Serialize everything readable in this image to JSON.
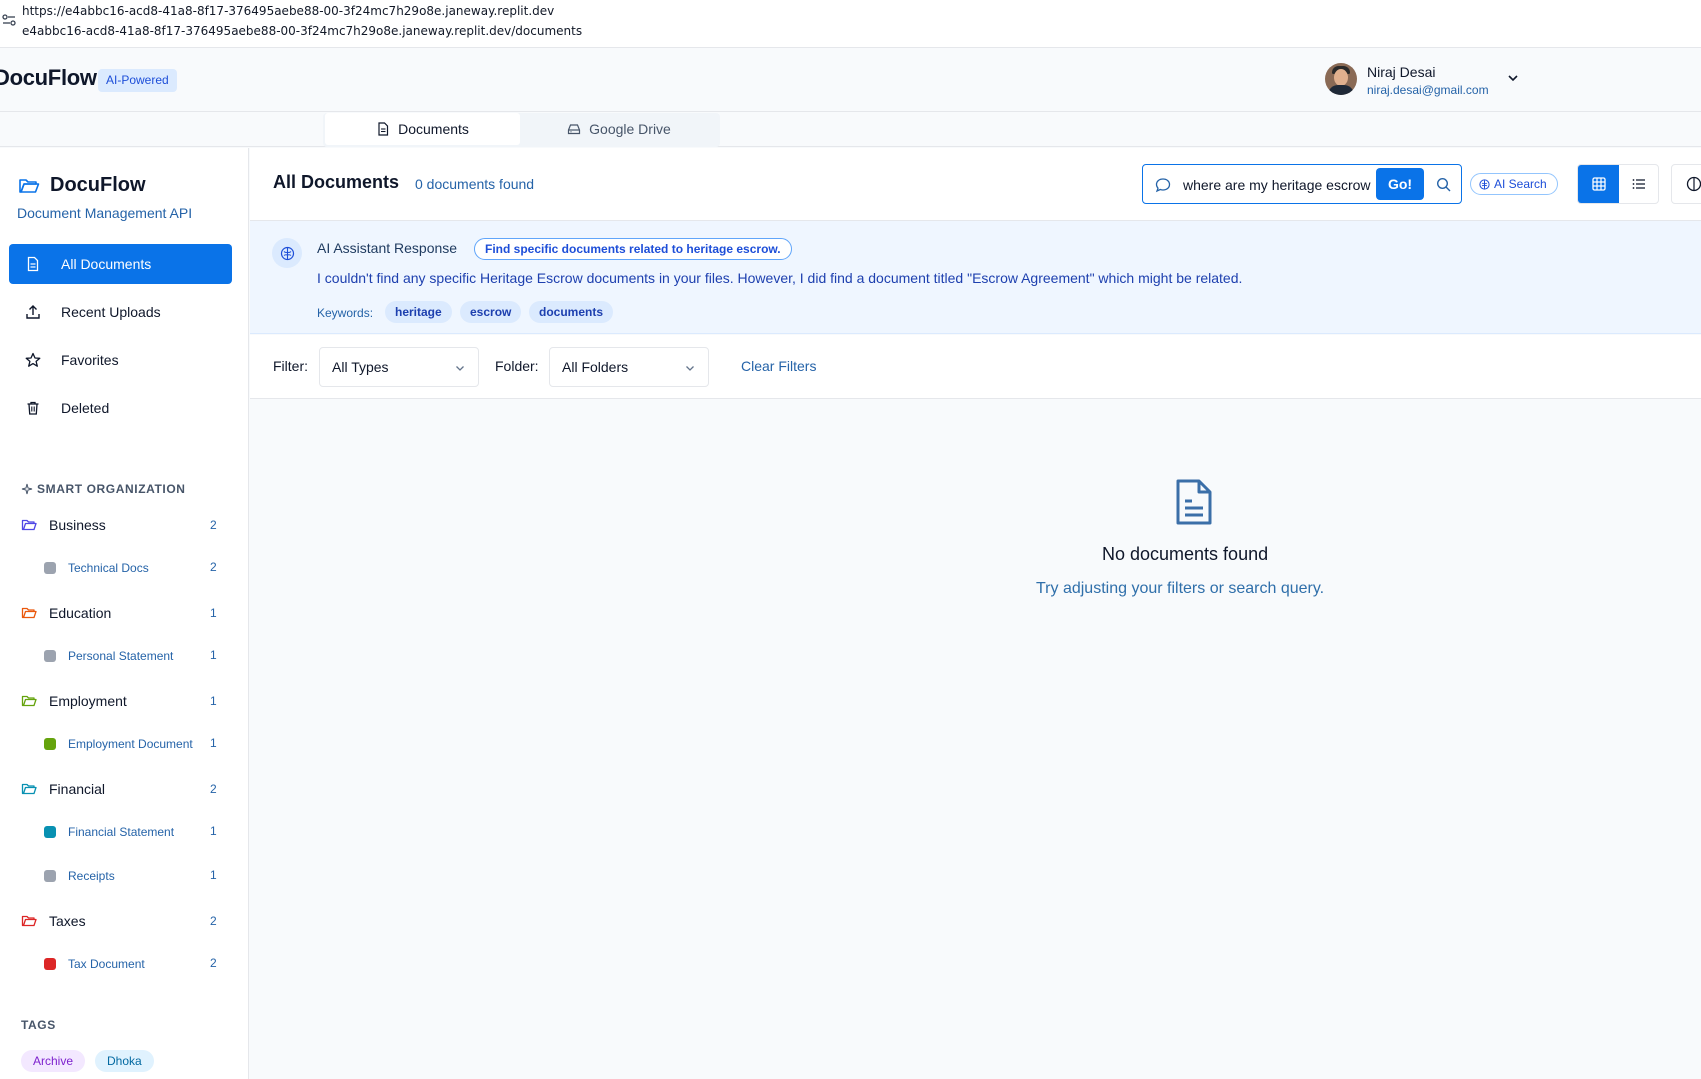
{
  "browser": {
    "url_line1": "https://e4abbc16-acd8-41a8-8f17-376495aebe88-00-3f24mc7h29o8e.janeway.replit.dev",
    "url_line2": "e4abbc16-acd8-41a8-8f17-376495aebe88-00-3f24mc7h29o8e.janeway.replit.dev/documents"
  },
  "header": {
    "brand": "DocuFlow",
    "badge": "AI-Powered",
    "user": {
      "name": "Niraj Desai",
      "email": "niraj.desai@gmail.com"
    }
  },
  "tabs": [
    {
      "label": "Documents",
      "icon": "file-icon",
      "active": true
    },
    {
      "label": "Google Drive",
      "icon": "drive-icon",
      "active": false
    }
  ],
  "sidebar": {
    "title": "DocuFlow",
    "subtitle": "Document Management API",
    "nav": [
      {
        "label": "All Documents",
        "icon": "file-icon",
        "active": true
      },
      {
        "label": "Recent Uploads",
        "icon": "upload-icon",
        "active": false
      },
      {
        "label": "Favorites",
        "icon": "star-icon",
        "active": false
      },
      {
        "label": "Deleted",
        "icon": "trash-icon",
        "active": false
      }
    ],
    "smart_label": "SMART ORGANIZATION",
    "folders": [
      {
        "label": "Business",
        "count": "2",
        "color": "#4f46e5",
        "children": [
          {
            "label": "Technical Docs",
            "count": "2",
            "color": "#9ca3af"
          }
        ]
      },
      {
        "label": "Education",
        "count": "1",
        "color": "#ea580c",
        "children": [
          {
            "label": "Personal Statement",
            "count": "1",
            "color": "#9ca3af"
          }
        ]
      },
      {
        "label": "Employment",
        "count": "1",
        "color": "#65a30d",
        "children": [
          {
            "label": "Employment Document",
            "count": "1",
            "color": "#65a30d"
          }
        ]
      },
      {
        "label": "Financial",
        "count": "2",
        "color": "#0891b2",
        "children": [
          {
            "label": "Financial Statement",
            "count": "1",
            "color": "#0891b2"
          },
          {
            "label": "Receipts",
            "count": "1",
            "color": "#9ca3af"
          }
        ]
      },
      {
        "label": "Taxes",
        "count": "2",
        "color": "#dc2626",
        "children": [
          {
            "label": "Tax Document",
            "count": "2",
            "color": "#dc2626"
          }
        ]
      }
    ],
    "tags_label": "TAGS",
    "tags": [
      {
        "label": "Archive",
        "bg": "#f3e8ff",
        "fg": "#7e22ce"
      },
      {
        "label": "Dhoka",
        "bg": "#e0f2fe",
        "fg": "#0369a1"
      }
    ]
  },
  "main": {
    "title": "All Documents",
    "count_text": "0 documents found",
    "search": {
      "value": "where are my heritage escrow",
      "go_label": "Go!"
    },
    "ai_search_label": "AI Search",
    "ai_response": {
      "title": "AI Assistant Response",
      "intent": "Find specific documents related to heritage escrow.",
      "message": "I couldn't find any specific Heritage Escrow documents in your files. However, I did find a document titled \"Escrow Agreement\" which might be related.",
      "keywords_label": "Keywords:",
      "keywords": [
        "heritage",
        "escrow",
        "documents"
      ]
    },
    "filters": {
      "filter_label": "Filter:",
      "type_value": "All Types",
      "folder_label": "Folder:",
      "folder_value": "All Folders",
      "clear_label": "Clear Filters"
    },
    "empty": {
      "title": "No documents found",
      "subtitle": "Try adjusting your filters or search query."
    }
  },
  "colors": {
    "accent": "#0a73e8",
    "link": "#2563a8"
  }
}
